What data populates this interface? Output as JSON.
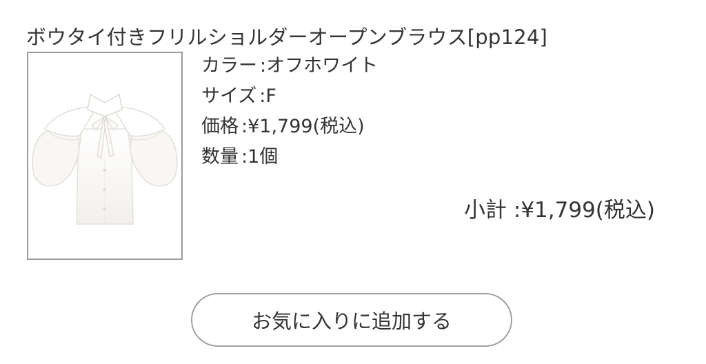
{
  "product": {
    "title": "ボウタイ付きフリルショルダーオープンブラウス[pp124]",
    "image_icon": "blouse-product-image",
    "color_label": "カラー",
    "color_value": "オフホワイト",
    "size_label": "サイズ",
    "size_value": "F",
    "price_label": "価格",
    "price_value": "¥1,799(税込)",
    "qty_label": "数量",
    "qty_value": "1個"
  },
  "summary": {
    "subtotal_label": "小計",
    "subtotal_value": "¥1,799(税込)"
  },
  "actions": {
    "favorite_label": "お気に入りに追加する"
  },
  "colors": {
    "text": "#333333",
    "border": "#9a9a9a",
    "background": "#ffffff"
  }
}
